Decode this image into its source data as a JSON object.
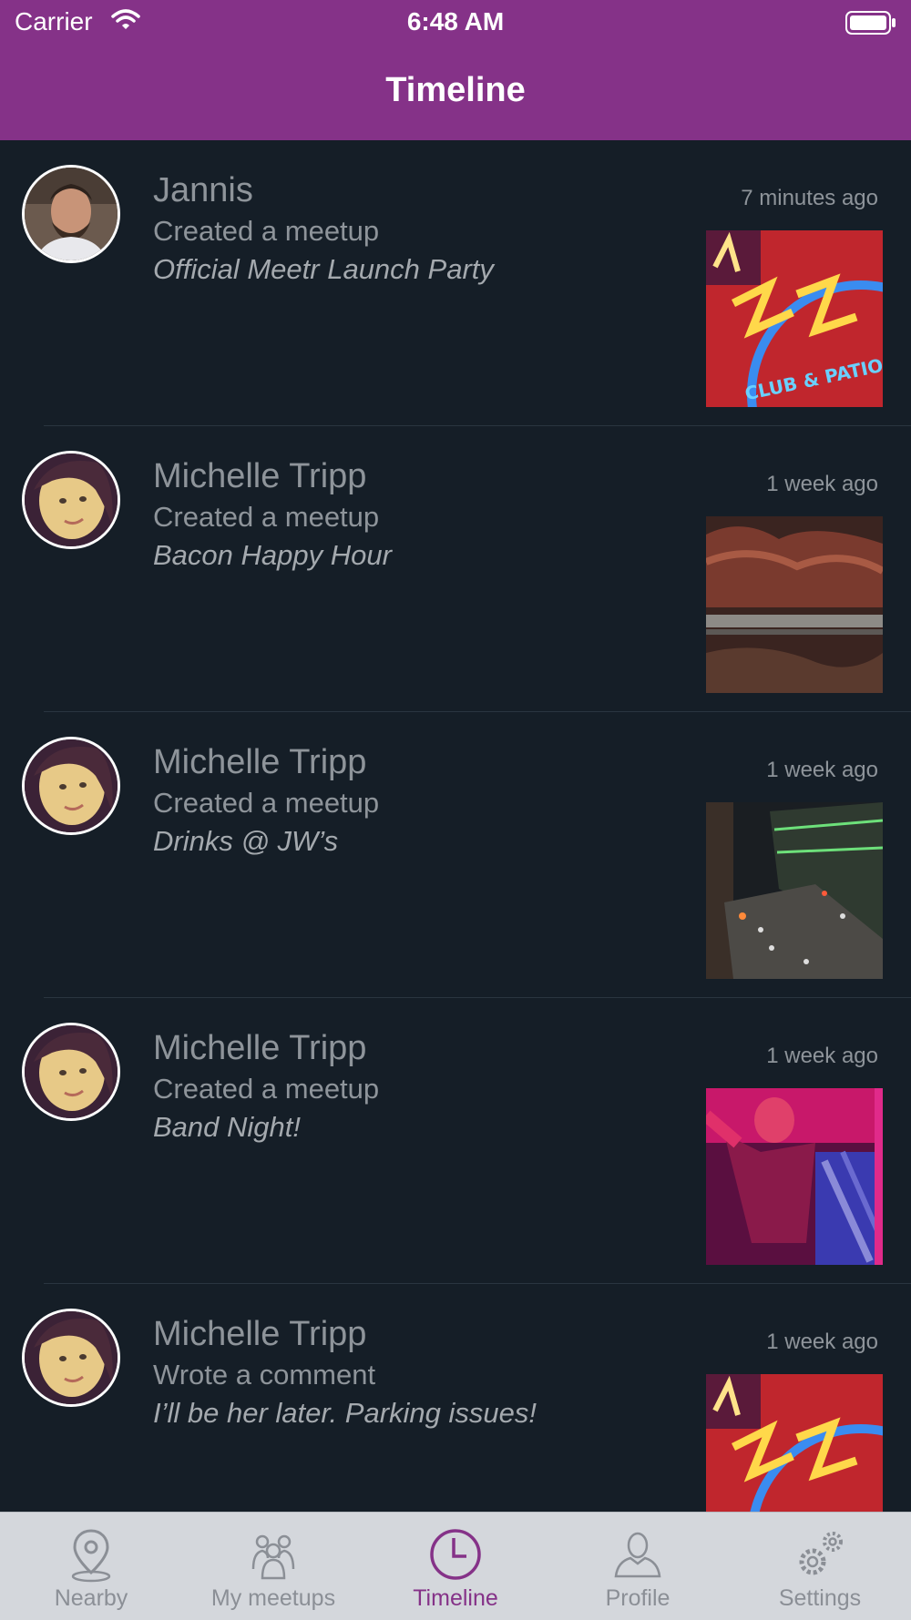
{
  "status_bar": {
    "carrier": "Carrier",
    "time": "6:48 AM"
  },
  "nav": {
    "title": "Timeline"
  },
  "feed": [
    {
      "name": "Jannis",
      "action": "Created a meetup",
      "detail": "Official Meetr Launch Party",
      "time": "7 minutes ago",
      "thumb": "neon-sign"
    },
    {
      "name": "Michelle Tripp",
      "action": "Created a meetup",
      "detail": "Bacon Happy Hour",
      "time": "1 week ago",
      "thumb": "bacon"
    },
    {
      "name": "Michelle Tripp",
      "action": "Created a meetup",
      "detail": "Drinks @ JW’s",
      "time": "1 week ago",
      "thumb": "street"
    },
    {
      "name": "Michelle Tripp",
      "action": "Created a meetup",
      "detail": "Band Night!",
      "time": "1 week ago",
      "thumb": "band"
    },
    {
      "name": "Michelle Tripp",
      "action": "Wrote a comment",
      "detail": "I’ll be her later. Parking issues!",
      "time": "1 week ago",
      "thumb": "neon-sign"
    }
  ],
  "tabbar": {
    "active": "Timeline",
    "tabs": [
      {
        "label": "Nearby",
        "icon": "location-pin-icon"
      },
      {
        "label": "My meetups",
        "icon": "group-icon"
      },
      {
        "label": "Timeline",
        "icon": "clock-icon"
      },
      {
        "label": "Profile",
        "icon": "person-icon"
      },
      {
        "label": "Settings",
        "icon": "gears-icon"
      }
    ]
  },
  "colors": {
    "accent": "#853288",
    "background": "#151e27",
    "tabbar": "#d4d7dc"
  }
}
